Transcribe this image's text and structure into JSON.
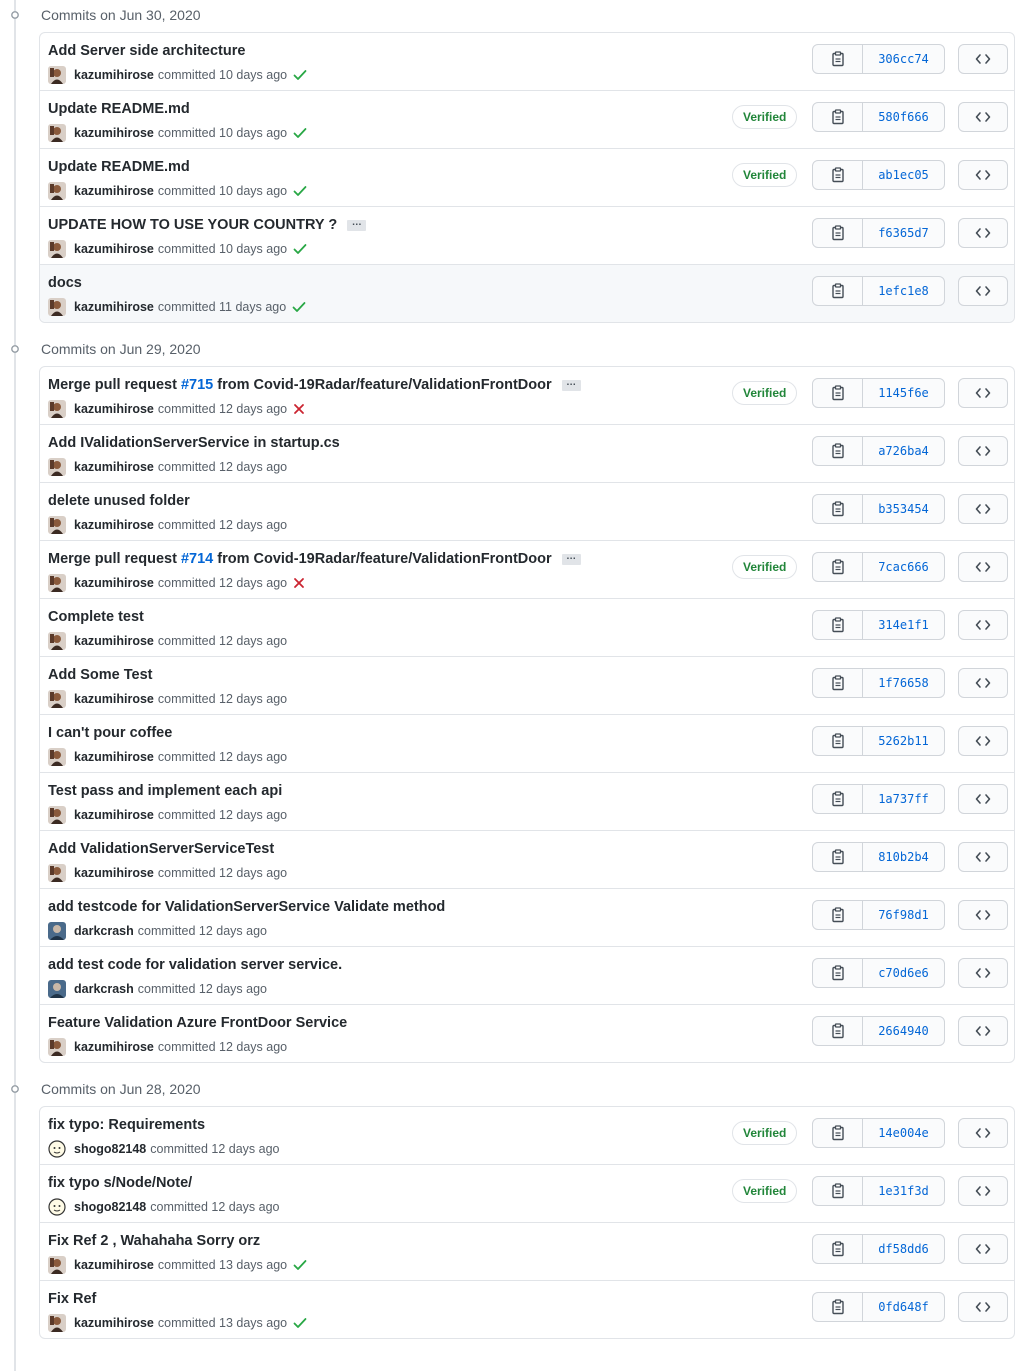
{
  "groups": [
    {
      "title": "Commits on Jun 30, 2020",
      "commits": [
        {
          "message": "Add Server side architecture",
          "author": "kazumihirose",
          "time": "committed 10 days ago",
          "status": "success",
          "verified": false,
          "sha": "306cc74",
          "ellipsis": false,
          "avatar": "kazumi"
        },
        {
          "message": "Update README.md",
          "author": "kazumihirose",
          "time": "committed 10 days ago",
          "status": "success",
          "verified": true,
          "sha": "580f666",
          "ellipsis": false,
          "avatar": "kazumi"
        },
        {
          "message": "Update README.md",
          "author": "kazumihirose",
          "time": "committed 10 days ago",
          "status": "success",
          "verified": true,
          "sha": "ab1ec05",
          "ellipsis": false,
          "avatar": "kazumi"
        },
        {
          "message": "UPDATE HOW TO USE YOUR COUNTRY ?",
          "author": "kazumihirose",
          "time": "committed 10 days ago",
          "status": "success",
          "verified": false,
          "sha": "f6365d7",
          "ellipsis": true,
          "avatar": "kazumi"
        },
        {
          "message": "docs",
          "author": "kazumihirose",
          "time": "committed 11 days ago",
          "status": "success",
          "verified": false,
          "sha": "1efc1e8",
          "ellipsis": false,
          "avatar": "kazumi",
          "highlight": true
        }
      ]
    },
    {
      "title": "Commits on Jun 29, 2020",
      "commits": [
        {
          "message_prefix": "Merge pull request ",
          "issue": "#715",
          "message_suffix": " from Covid-19Radar/feature/ValidationFrontDoor",
          "author": "kazumihirose",
          "time": "committed 12 days ago",
          "status": "failure",
          "verified": true,
          "sha": "1145f6e",
          "ellipsis": true,
          "avatar": "kazumi"
        },
        {
          "message": "Add IValidationServerService in startup.cs",
          "author": "kazumihirose",
          "time": "committed 12 days ago",
          "status": "none",
          "verified": false,
          "sha": "a726ba4",
          "ellipsis": false,
          "avatar": "kazumi"
        },
        {
          "message": "delete unused folder",
          "author": "kazumihirose",
          "time": "committed 12 days ago",
          "status": "none",
          "verified": false,
          "sha": "b353454",
          "ellipsis": false,
          "avatar": "kazumi"
        },
        {
          "message_prefix": "Merge pull request ",
          "issue": "#714",
          "message_suffix": " from Covid-19Radar/feature/ValidationFrontDoor",
          "author": "kazumihirose",
          "time": "committed 12 days ago",
          "status": "failure",
          "verified": true,
          "sha": "7cac666",
          "ellipsis": true,
          "avatar": "kazumi"
        },
        {
          "message": "Complete test",
          "author": "kazumihirose",
          "time": "committed 12 days ago",
          "status": "none",
          "verified": false,
          "sha": "314e1f1",
          "ellipsis": false,
          "avatar": "kazumi"
        },
        {
          "message": "Add Some Test",
          "author": "kazumihirose",
          "time": "committed 12 days ago",
          "status": "none",
          "verified": false,
          "sha": "1f76658",
          "ellipsis": false,
          "avatar": "kazumi"
        },
        {
          "message": "I can't pour coffee",
          "author": "kazumihirose",
          "time": "committed 12 days ago",
          "status": "none",
          "verified": false,
          "sha": "5262b11",
          "ellipsis": false,
          "avatar": "kazumi"
        },
        {
          "message": "Test pass and implement each api",
          "author": "kazumihirose",
          "time": "committed 12 days ago",
          "status": "none",
          "verified": false,
          "sha": "1a737ff",
          "ellipsis": false,
          "avatar": "kazumi"
        },
        {
          "message": "Add ValidationServerServiceTest",
          "author": "kazumihirose",
          "time": "committed 12 days ago",
          "status": "none",
          "verified": false,
          "sha": "810b2b4",
          "ellipsis": false,
          "avatar": "kazumi"
        },
        {
          "message": "add testcode for ValidationServerService Validate method",
          "author": "darkcrash",
          "time": "committed 12 days ago",
          "status": "none",
          "verified": false,
          "sha": "76f98d1",
          "ellipsis": false,
          "avatar": "dark"
        },
        {
          "message": "add test code for validation server service.",
          "author": "darkcrash",
          "time": "committed 12 days ago",
          "status": "none",
          "verified": false,
          "sha": "c70d6e6",
          "ellipsis": false,
          "avatar": "dark"
        },
        {
          "message": "Feature Validation Azure FrontDoor Service",
          "author": "kazumihirose",
          "time": "committed 12 days ago",
          "status": "none",
          "verified": false,
          "sha": "2664940",
          "ellipsis": false,
          "avatar": "kazumi"
        }
      ]
    },
    {
      "title": "Commits on Jun 28, 2020",
      "commits": [
        {
          "message": "fix typo: Requirements",
          "author": "shogo82148",
          "time": "committed 12 days ago",
          "status": "none",
          "verified": true,
          "sha": "14e004e",
          "ellipsis": false,
          "avatar": "shogo"
        },
        {
          "message": "fix typo s/Node/Note/",
          "author": "shogo82148",
          "time": "committed 12 days ago",
          "status": "none",
          "verified": true,
          "sha": "1e31f3d",
          "ellipsis": false,
          "avatar": "shogo"
        },
        {
          "message": "Fix Ref 2 , Wahahaha Sorry orz",
          "author": "kazumihirose",
          "time": "committed 13 days ago",
          "status": "success",
          "verified": false,
          "sha": "df58dd6",
          "ellipsis": false,
          "avatar": "kazumi"
        },
        {
          "message": "Fix Ref",
          "author": "kazumihirose",
          "time": "committed 13 days ago",
          "status": "success",
          "verified": false,
          "sha": "0fd648f",
          "ellipsis": false,
          "avatar": "kazumi"
        }
      ]
    }
  ],
  "labels": {
    "verified": "Verified",
    "ellipsis": "…"
  },
  "icons": {
    "timeline_node": "commit-node-icon",
    "copy": "clipboard-icon",
    "browse": "code-brackets-icon",
    "success": "check-icon",
    "failure": "x-icon"
  },
  "colors": {
    "link": "#0366d6",
    "success": "#28a745",
    "failure": "#cb2431",
    "verified": "#22863a",
    "border": "#e1e4e8"
  }
}
